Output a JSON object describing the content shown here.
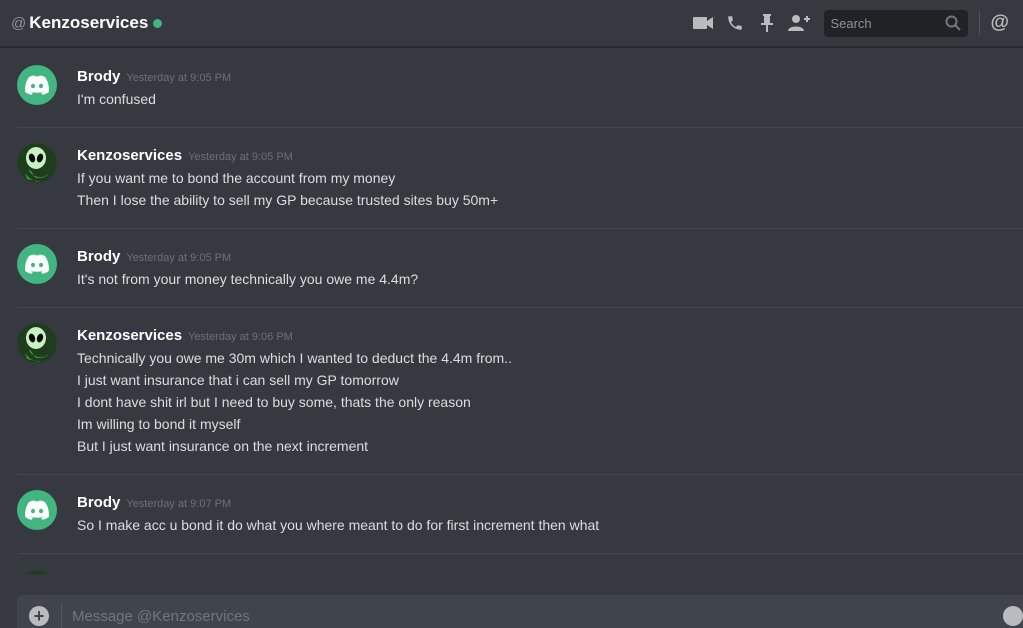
{
  "header": {
    "at_symbol": "@",
    "title": "Kenzoservices",
    "status_color": "#43b581",
    "icons": [
      "video-camera-icon",
      "phone-icon",
      "pin-icon",
      "add-friend-icon"
    ],
    "search_placeholder": "Search",
    "mentions_symbol": "@"
  },
  "messages": [
    {
      "author": "Brody",
      "timestamp": "Yesterday at 9:05 PM",
      "avatar": "discord-logo",
      "lines": [
        "I'm confused"
      ]
    },
    {
      "author": "Kenzoservices",
      "timestamp": "Yesterday at 9:05 PM",
      "avatar": "alien-avatar",
      "lines": [
        "If you want me to bond the account from my money",
        "Then I lose the ability to sell my GP because trusted sites buy 50m+"
      ]
    },
    {
      "author": "Brody",
      "timestamp": "Yesterday at 9:05 PM",
      "avatar": "discord-logo",
      "lines": [
        "It's not from your money technically you owe me 4.4m?"
      ]
    },
    {
      "author": "Kenzoservices",
      "timestamp": "Yesterday at 9:06 PM",
      "avatar": "alien-avatar",
      "lines": [
        "Technically you owe me 30m which I wanted to deduct the 4.4m from..",
        "I just want insurance that i can sell my GP tomorrow",
        "I dont have shit irl but I need to buy some, thats the only reason",
        "Im willing to bond it myself",
        "But I just want insurance on the next increment"
      ]
    },
    {
      "author": "Brody",
      "timestamp": "Yesterday at 9:07 PM",
      "avatar": "discord-logo",
      "lines": [
        "So I make acc u bond it do what you where meant to do for first increment then what"
      ]
    }
  ],
  "composer": {
    "placeholder": "Message @Kenzoservices"
  },
  "colors": {
    "background": "#36393f",
    "accent_green": "#43b581",
    "input_bg": "#40444b"
  }
}
